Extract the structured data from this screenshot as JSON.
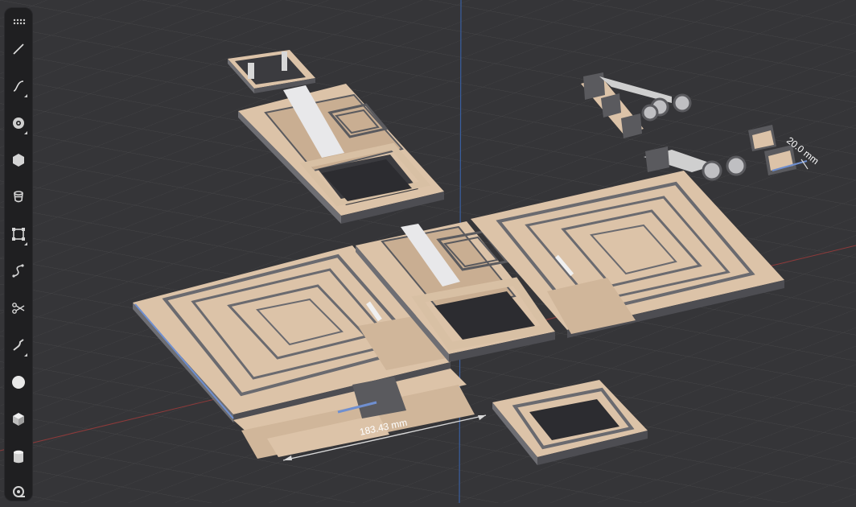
{
  "toolbar": {
    "tools": [
      {
        "name": "line-tool",
        "icon": "line-icon"
      },
      {
        "name": "curve-tool",
        "icon": "curve-icon"
      },
      {
        "name": "circle-tool",
        "icon": "circle-target-icon"
      },
      {
        "name": "polygon-tool",
        "icon": "hexagon-icon"
      },
      {
        "name": "loft-tool",
        "icon": "stack-icon"
      },
      {
        "name": "transform-tool",
        "icon": "bounding-box-icon"
      },
      {
        "name": "path-tool",
        "icon": "path-icon"
      },
      {
        "name": "split-tool",
        "icon": "scissors-icon"
      },
      {
        "name": "sweep-tool",
        "icon": "sweep-icon"
      },
      {
        "name": "sphere-tool",
        "icon": "sphere-icon"
      },
      {
        "name": "cube-tool",
        "icon": "cube-icon"
      },
      {
        "name": "cylinder-tool",
        "icon": "cylinder-icon"
      },
      {
        "name": "measure-tool",
        "icon": "tape-measure-icon"
      }
    ],
    "menu_icon": "grid-dots-icon"
  },
  "measurements": {
    "width_label": "183.43 mm",
    "height_label": "20.0 mm"
  },
  "colors": {
    "background": "#353538",
    "model_top": "#dcc3a8",
    "model_side": "#7b7b80",
    "x_axis": "#9b3a3a",
    "y_axis": "#3a5fa0",
    "selection": "#6f8fd0"
  }
}
